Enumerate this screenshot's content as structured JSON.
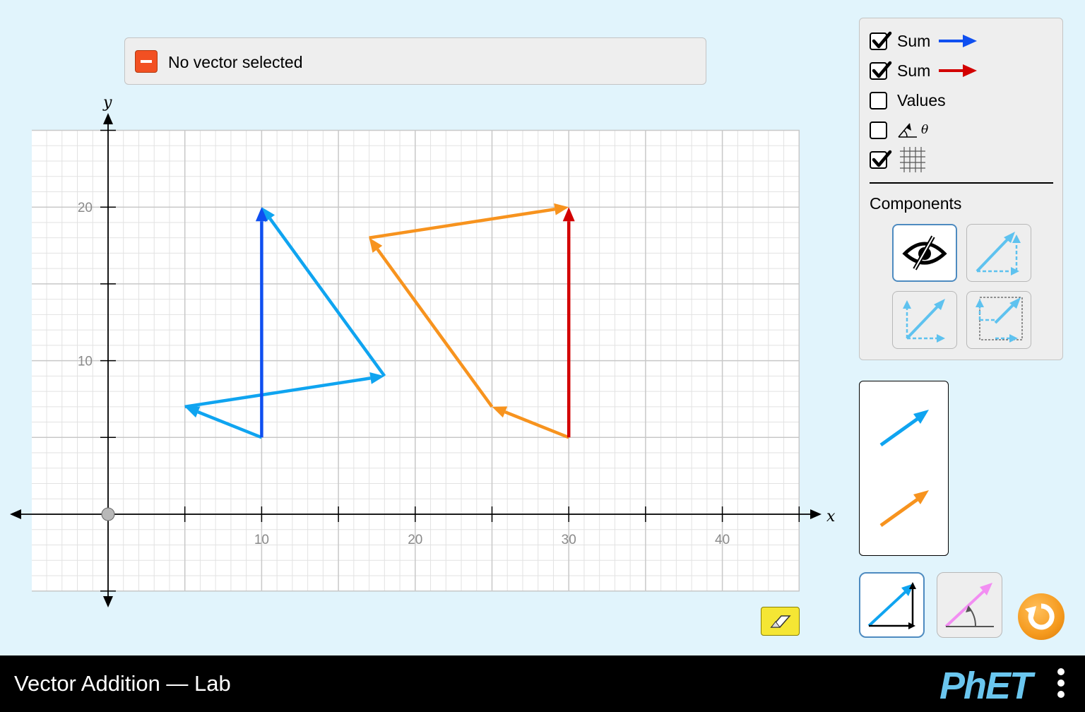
{
  "status": {
    "text": "No vector selected"
  },
  "graph": {
    "x_axis_label": "x",
    "y_axis_label": "y",
    "x_tick_labels": [
      "10",
      "20",
      "30",
      "40"
    ],
    "y_tick_labels": [
      "10",
      "20"
    ],
    "grid_visible": true
  },
  "vector_sets": [
    {
      "color": "#0fa4f0",
      "sum_color": "#0f4ff0",
      "vectors": [
        {
          "tail": [
            10,
            5
          ],
          "tip": [
            5,
            7
          ]
        },
        {
          "tail": [
            5,
            7
          ],
          "tip": [
            18,
            9
          ]
        },
        {
          "tail": [
            18,
            9
          ],
          "tip": [
            10,
            20
          ]
        }
      ],
      "sum": {
        "tail": [
          10,
          5
        ],
        "tip": [
          10,
          20
        ]
      }
    },
    {
      "color": "#f7931e",
      "sum_color": "#d20000",
      "vectors": [
        {
          "tail": [
            30,
            5
          ],
          "tip": [
            25,
            7
          ]
        },
        {
          "tail": [
            25,
            7
          ],
          "tip": [
            17,
            18
          ]
        },
        {
          "tail": [
            17,
            18
          ],
          "tip": [
            30,
            20
          ]
        }
      ],
      "sum": {
        "tail": [
          30,
          5
        ],
        "tip": [
          30,
          20
        ]
      }
    }
  ],
  "panel": {
    "checkboxes": [
      {
        "label": "Sum",
        "checked": true,
        "arrow_color": "#0f4ff0"
      },
      {
        "label": "Sum",
        "checked": true,
        "arrow_color": "#d20000"
      },
      {
        "label": "Values",
        "checked": false
      },
      {
        "label": "",
        "icon": "angle-icon",
        "checked": false
      },
      {
        "label": "",
        "icon": "grid-icon",
        "checked": true
      }
    ],
    "angle_symbol": "θ",
    "components_label": "Components",
    "component_styles": [
      "invisible",
      "triangle",
      "parallelogram",
      "projection"
    ],
    "selected_component_style": "invisible"
  },
  "creator_panel": {
    "vector_colors": [
      "#0fa4f0",
      "#f7931e"
    ]
  },
  "coordinate_modes": {
    "selected": "cartesian",
    "options": [
      "cartesian",
      "polar"
    ]
  },
  "navbar": {
    "title": "Vector Addition — Lab",
    "logo": "PhET"
  }
}
